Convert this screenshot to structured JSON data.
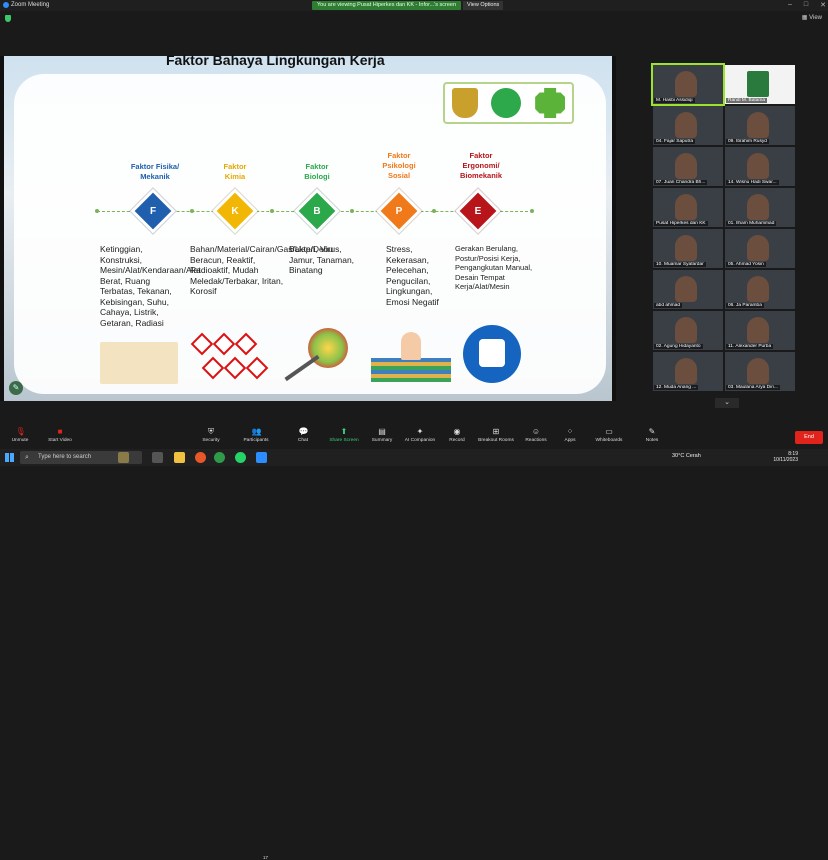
{
  "window": {
    "app_title": "Zoom Meeting",
    "viewing_banner": "You are viewing Pusat Hiperkes dan KK - Infor...'s screen",
    "view_options": "View Options",
    "view_label": "View"
  },
  "slide": {
    "title": "Faktor Bahaya Lingkungan Kerja",
    "factors": [
      {
        "head": "Faktor Fisika/ Mekanik",
        "letter": "F",
        "color": "#1f5fae",
        "body": "Ketinggian, Konstruksi, Mesin/Alat/Kendaraan/Alat Berat, Ruang Terbatas, Tekanan, Kebisingan, Suhu, Cahaya, Listrik, Getaran, Radiasi"
      },
      {
        "head": "Faktor Kimia",
        "letter": "K",
        "color": "#f2b705",
        "body": "Bahan/Material/Cairan/Gas/Uap/Debu Beracun, Reaktif, Radioaktif, Mudah Meledak/Terbakar, Iritan, Korosif"
      },
      {
        "head": "Faktor Biologi",
        "letter": "B",
        "color": "#2aa84a",
        "body": "Bakteri, Virus, Jamur, Tanaman, Binatang"
      },
      {
        "head": "Faktor Psikologi Sosial",
        "letter": "P",
        "color": "#f07a1a",
        "body": "Stress, Kekerasan, Pelecehan, Pengucilan, Lingkungan, Emosi Negatif"
      },
      {
        "head": "Faktor Ergonomi/ Biomekanik",
        "letter": "E",
        "color": "#b8151b",
        "body": "Gerakan Berulang, Postur/Posisi Kerja, Pengangkutan Manual, Desain Tempat Kerja/Alat/Mesin"
      }
    ]
  },
  "gallery": {
    "participants": [
      "M. Hasbi Assidiqi",
      "Randi M. Batama",
      "04. Fajar Saputra",
      "09. Ibrahim Rusyd",
      "07. Juan Chandra Bh...",
      "14. Wisnu Hadi Swar...",
      "Pusat Hiperkes dan KK",
      "01. Ilham Muhammad",
      "10. Muamar Syafardar",
      "05. Ahmad Yosin",
      "abd ahmad",
      "06. Ja Paramba",
      "02. Agung Hidayanto",
      "11. Alexander Purba",
      "12. Muda Anang ...",
      "03. Maulana Arya Diri..."
    ]
  },
  "toolbar": {
    "items": [
      "Unmute",
      "Start Video",
      "Security",
      "Participants",
      "Chat",
      "Share Screen",
      "Summary",
      "AI Companion",
      "Record",
      "Breakout Rooms",
      "Reactions",
      "Apps",
      "Whiteboards",
      "Notes"
    ],
    "participants_count": "17",
    "end_label": "End"
  },
  "taskbar": {
    "search_placeholder": "Type here to search",
    "weather": "30°C  Cerah",
    "time": "8:19",
    "date": "10/11/2023"
  },
  "colors": {
    "accent_green": "#3ad07a",
    "end_red": "#e0241c"
  }
}
